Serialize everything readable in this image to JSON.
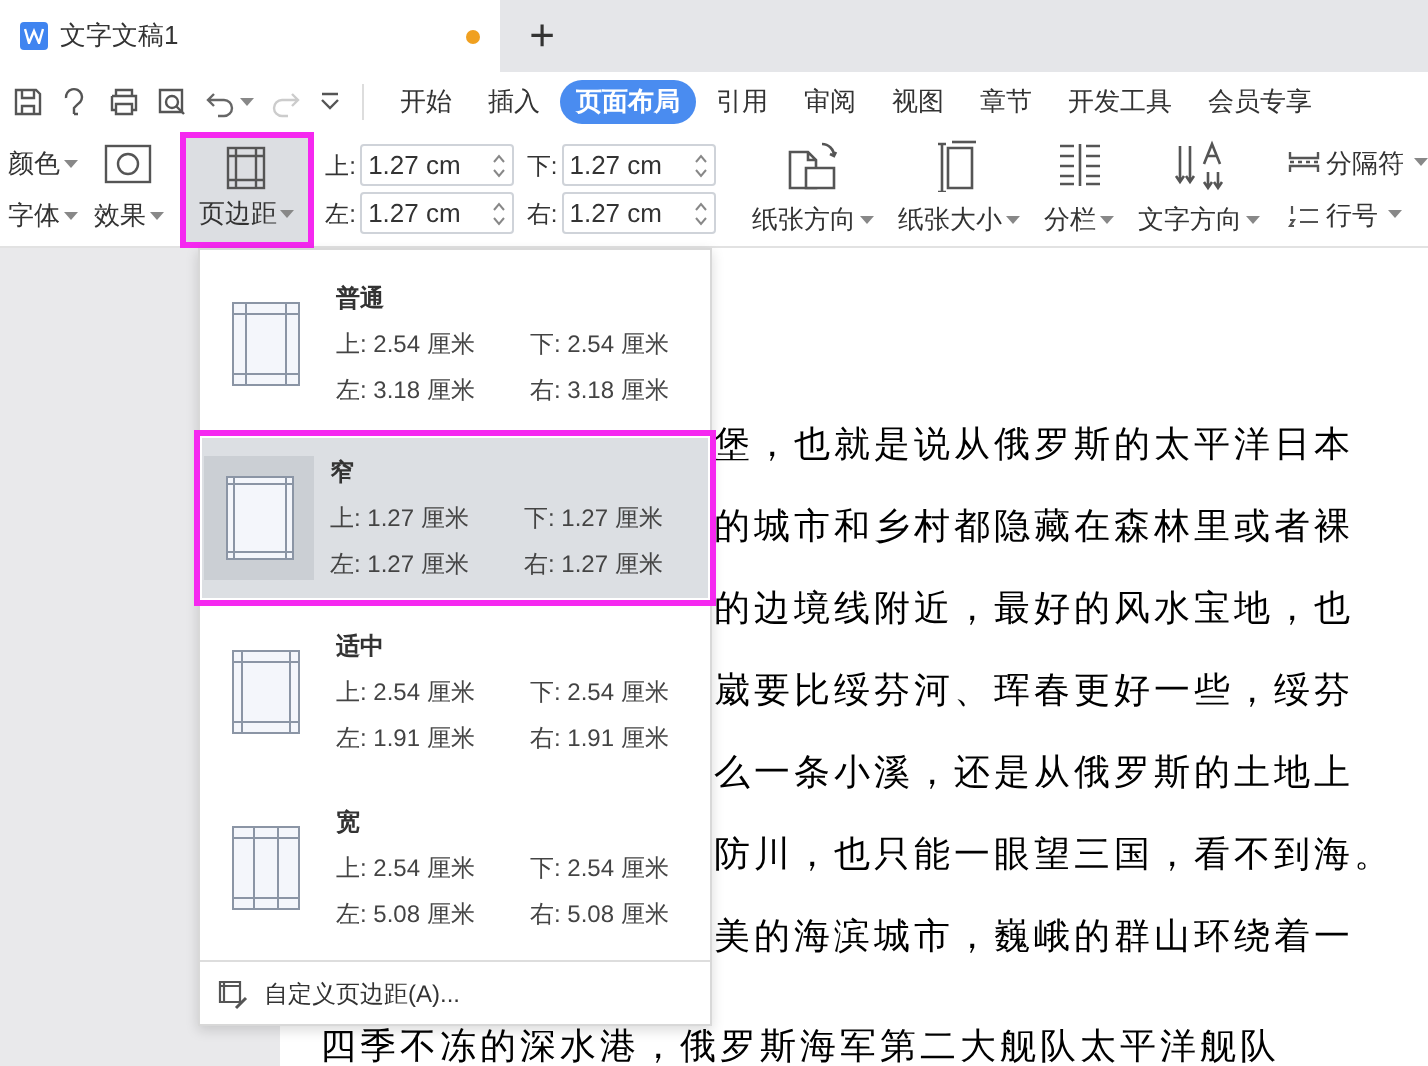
{
  "document_tab": {
    "title": "文字文稿1",
    "unsaved": true
  },
  "new_tab": "+",
  "menu_tabs": [
    {
      "label": "开始",
      "selected": false
    },
    {
      "label": "插入",
      "selected": false
    },
    {
      "label": "页面布局",
      "selected": true
    },
    {
      "label": "引用",
      "selected": false
    },
    {
      "label": "审阅",
      "selected": false
    },
    {
      "label": "视图",
      "selected": false
    },
    {
      "label": "章节",
      "selected": false
    },
    {
      "label": "开发工具",
      "selected": false
    },
    {
      "label": "会员专享",
      "selected": false
    }
  ],
  "ribbon": {
    "color_label": "颜色",
    "font_label": "字体",
    "effects_label": "效果",
    "margins_button": {
      "label": "页边距",
      "highlighted": true
    },
    "margin_fields": [
      {
        "label": "上:",
        "value": "1.27 cm"
      },
      {
        "label": "下:",
        "value": "1.27 cm"
      },
      {
        "label": "左:",
        "value": "1.27 cm"
      },
      {
        "label": "右:",
        "value": "1.27 cm"
      }
    ],
    "buttons": [
      {
        "kind": "orientation",
        "label": "纸张方向"
      },
      {
        "kind": "size",
        "label": "纸张大小"
      },
      {
        "kind": "columns",
        "label": "分栏"
      },
      {
        "kind": "direction",
        "label": "文字方向"
      }
    ],
    "break_label": "分隔符",
    "line_number_label": "行号"
  },
  "document_lines": [
    "堡，也就是说从俄罗斯的太平洋日本",
    "的城市和乡村都隐藏在森林里或者裸",
    "的边境线附近，最好的风水宝地，也",
    "崴要比绥芬河、珲春更好一些，绥芬",
    "么一条小溪，还是从俄罗斯的土地上",
    "防川，也只能一眼望三国，看不到海。",
    "美的海滨城市，巍峨的群山环绕着一"
  ],
  "document_last_line": "四季不冻的深水港，俄罗斯海军第二大舰队太平洋舰队",
  "margins_menu": {
    "presets": [
      {
        "kind": "normal",
        "name": "普通",
        "top": "上: 2.54 厘米",
        "bottom": "下: 2.54 厘米",
        "left": "左: 3.18 厘米",
        "right": "右: 3.18 厘米",
        "selected": false,
        "highlighted": false
      },
      {
        "kind": "narrow",
        "name": "窄",
        "top": "上: 1.27 厘米",
        "bottom": "下: 1.27 厘米",
        "left": "左: 1.27 厘米",
        "right": "右: 1.27 厘米",
        "selected": true,
        "highlighted": true
      },
      {
        "kind": "moderate",
        "name": "适中",
        "top": "上: 2.54 厘米",
        "bottom": "下: 2.54 厘米",
        "left": "左: 1.91 厘米",
        "right": "右: 1.91 厘米",
        "selected": false,
        "highlighted": false
      },
      {
        "kind": "wide",
        "name": "宽",
        "top": "上: 2.54 厘米",
        "bottom": "下: 2.54 厘米",
        "left": "左: 5.08 厘米",
        "right": "右: 5.08 厘米",
        "selected": false,
        "highlighted": false
      }
    ],
    "custom": "自定义页边距(A)..."
  }
}
